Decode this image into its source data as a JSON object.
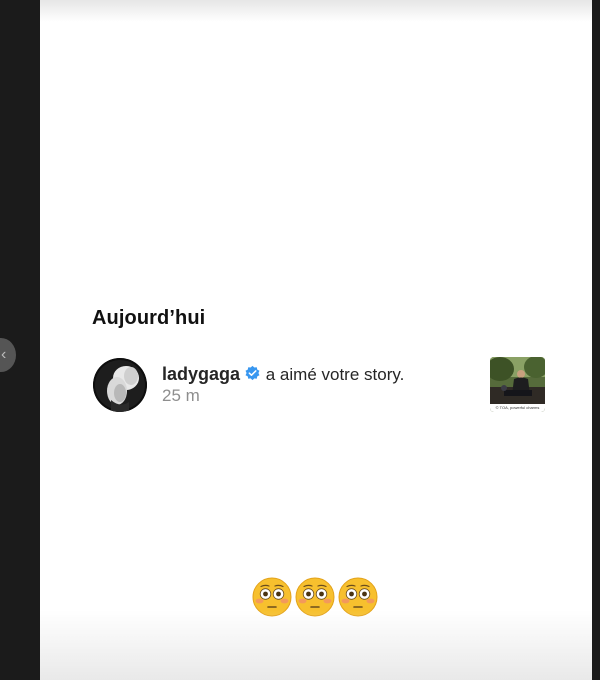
{
  "notifications": {
    "section_title": "Aujourd’hui",
    "items": [
      {
        "username": "ladygaga",
        "verified": true,
        "action_text": " a aimé votre story.",
        "time": "25 m",
        "avatar_icon": "profile-photo",
        "thumbnail_icon": "story-thumbnail",
        "thumbnail_caption": "© TOA, powerful charms"
      }
    ]
  },
  "reaction": {
    "emojis": [
      "flushed-face-emoji",
      "flushed-face-emoji",
      "flushed-face-emoji"
    ]
  },
  "colors": {
    "text": "#262626",
    "secondary_text": "#8e8e8e",
    "verified_blue": "#3897f0",
    "emoji_yellow": "#f7c02e"
  }
}
